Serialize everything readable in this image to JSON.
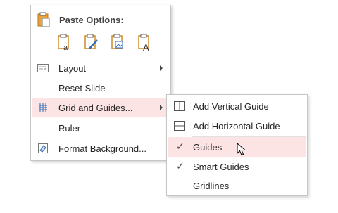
{
  "context_menu": {
    "paste_options_label": "Paste Options:",
    "paste_icons": [
      "paste-keep-formatting-icon",
      "paste-use-theme-icon",
      "paste-picture-icon",
      "paste-text-only-icon"
    ],
    "items": [
      {
        "label": "Layout",
        "submenu": true,
        "icon": "layout-icon"
      },
      {
        "label": "Reset Slide",
        "submenu": false,
        "icon": ""
      },
      {
        "label": "Grid and Guides...",
        "submenu": true,
        "icon": "grid-icon",
        "highlighted": true
      },
      {
        "label": "Ruler",
        "submenu": false,
        "icon": ""
      },
      {
        "label": "Format Background...",
        "submenu": false,
        "icon": "format-background-icon"
      }
    ]
  },
  "submenu": {
    "items": [
      {
        "label": "Add Vertical Guide",
        "icon": "vertical-guide-icon"
      },
      {
        "label": "Add Horizontal Guide",
        "icon": "horizontal-guide-icon"
      },
      {
        "label": "Guides",
        "checked": true,
        "highlighted": true
      },
      {
        "label": "Smart Guides",
        "checked": true
      },
      {
        "label": "Gridlines",
        "checked": false
      }
    ]
  },
  "colors": {
    "highlight": "#fce4e4",
    "icon_orange": "#d18b2a",
    "icon_blue": "#2e6db4"
  }
}
